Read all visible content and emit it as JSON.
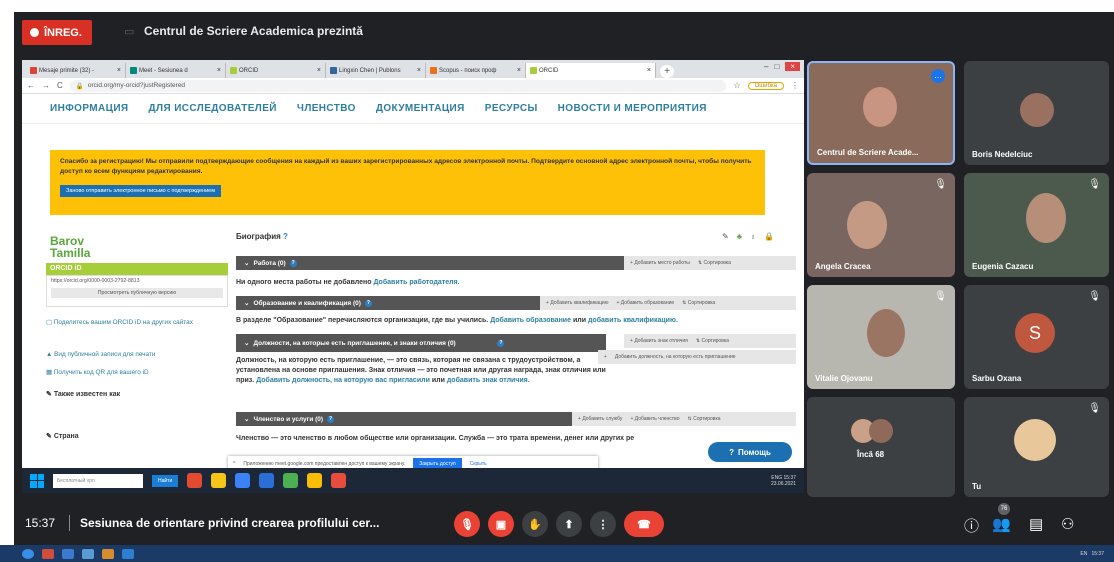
{
  "meet": {
    "recording_label": "ÎNREG.",
    "presenter_title": "Centrul de Scriere Academica prezintă",
    "clock": "15:37",
    "meeting_title": "Sesiunea de orientare privind crearea profilului cer...",
    "participant_count": "76"
  },
  "browser": {
    "tabs": [
      {
        "label": "Mesaje primite (32) - ",
        "color": "#db4437"
      },
      {
        "label": "Meet - Sesiunea d",
        "color": "#00897b"
      },
      {
        "label": "ORCID",
        "color": "#a6ce39"
      },
      {
        "label": "Lingxin Chen | Publons",
        "color": "#336699"
      },
      {
        "label": "Scopus - поиск проф",
        "color": "#e9711c"
      },
      {
        "label": "ORCID",
        "color": "#a6ce39"
      }
    ],
    "url": "orcid.org/my-orcid?justRegistered",
    "error_label": "Ошибка"
  },
  "orcid": {
    "nav": [
      "ИНФОРМАЦИЯ",
      "ДЛЯ ИССЛЕДОВАТЕЛЕЙ",
      "ЧЛЕНСТВО",
      "ДОКУМЕНТАЦИЯ",
      "РЕСУРСЫ",
      "НОВОСТИ И МЕРОПРИЯТИЯ"
    ],
    "banner_text": "Спасибо за регистрацию! Мы отправили подтверждающие сообщения на каждый из ваших зарегистрированных адресов электронной почты. Подтвердите основной адрес электронной почты, чтобы получить доступ ко всем функциям редактирования.",
    "resend_button": "Заново отправить электронное письмо с подтверждением",
    "first_name": "Barov",
    "last_name": "Tamilla",
    "orcid_header": "ORCID iD",
    "orcid_url": "https://orcid.org/0000-0003-2792-8813",
    "public_version": "Просмотреть публичную версию",
    "share_link": "Поделитесь вашим ORCID iD на других сайтах",
    "print_link": "Вид публичной записи для печати",
    "qr_link": "Получить код QR для вашего iD",
    "also_known": "Также известен как",
    "country": "Страна",
    "biography": "Биография",
    "work_header": "Работа (0)",
    "work_add": "Добавить место работы",
    "sort": "Сортировка",
    "work_text": "Ни одного места работы не добавлено",
    "work_link": "Добавить работодателя.",
    "edu_header": "Образование и квалификация (0)",
    "edu_add_qual": "Добавить квалификацию",
    "edu_add_edu": "Добавить образование",
    "edu_text": "В разделе \"Образование\" перечисляются организации, где вы учились.",
    "edu_link1": "Добавить образование",
    "edu_or": "или",
    "edu_link2": "добавить квалификацию.",
    "inv_header": "Должности, на которые есть приглашение, и знаки отличия (0)",
    "inv_add_badge": "Добавить знак отличия",
    "inv_add_pos": "Добавить должность, на которую есть приглашение",
    "inv_text": "Должность, на которую есть приглашение, — это связь, которая не связана с трудоустройством, а установлена на основе приглашения. Знак отличия — это почетная или другая награда, знак отличия или приз.",
    "inv_link1": "Добавить должность, на которую вас пригласили",
    "inv_or": "или",
    "inv_link2": "добавить знак отличия.",
    "mem_header": "Членство и услуги (0)",
    "mem_add_service": "Добавить службу",
    "mem_add_member": "Добавить членство",
    "mem_text": "Членство — это членство в любом обществе или организации. Служба — это трата времени, денег или других ре",
    "help": "Помощь"
  },
  "notification": {
    "text": "Приложению meet.google.com предоставлен доступ к вашему экрану.",
    "stop": "Закрыть доступ",
    "hide": "Скрыть"
  },
  "taskbar": {
    "search_placeholder": "Бесплатный vpn",
    "find": "Найти",
    "lang": "ENG",
    "time": "15:37",
    "date": "23.06.2021"
  },
  "participants": [
    {
      "name": "Centrul de Scriere Acade...",
      "muted": false
    },
    {
      "name": "Boris Nedelciuc",
      "muted": false
    },
    {
      "name": "Angela Cracea",
      "muted": true
    },
    {
      "name": "Eugenia Cazacu",
      "muted": true
    },
    {
      "name": "Vitalie Ojovanu",
      "muted": true
    },
    {
      "name": "Sarbu Oxana",
      "muted": true,
      "initial": "S"
    },
    {
      "name": "Încă 68",
      "muted": false
    },
    {
      "name": "Tu",
      "muted": true
    }
  ],
  "host_taskbar": {
    "lang": "EN",
    "time": "15:37"
  }
}
